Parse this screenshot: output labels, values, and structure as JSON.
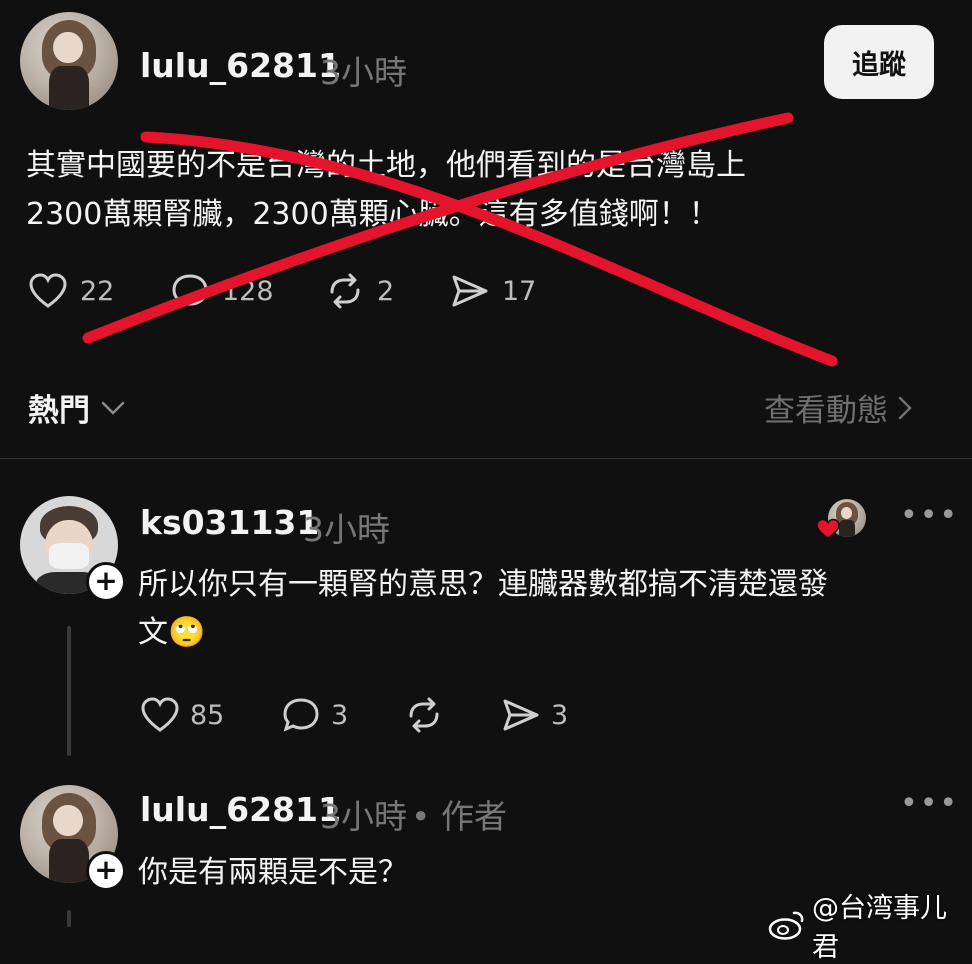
{
  "post": {
    "username": "lulu_62811",
    "time": "3小時",
    "follow_label": "追蹤",
    "text_line1": "其實中國要的不是台灣的土地，他們看到的是台灣島上",
    "text_line2": "2300萬顆腎臟，2300萬顆心臟。這有多值錢啊！！",
    "likes": "22",
    "replies": "128",
    "reposts": "2",
    "shares": "17",
    "overlay_color": "#e3142b"
  },
  "sort": {
    "label": "熱門",
    "view_activity": "查看動態"
  },
  "comments": [
    {
      "username": "ks031131",
      "time": "3小時",
      "text_line1": "所以你只有一顆腎的意思？連臟器數都搞不清楚還發",
      "text_line2": "文🙄",
      "likes": "85",
      "replies": "3",
      "shares": "3"
    },
    {
      "username": "lulu_62811",
      "time": "3小時",
      "author_tag": "• 作者",
      "text_line1": "你是有兩顆是不是？"
    }
  ],
  "watermark": "@台湾事儿君",
  "icons": [
    "heart-icon",
    "comment-icon",
    "repost-icon",
    "share-icon",
    "chevron-down-icon",
    "chevron-right-icon",
    "more-icon",
    "weibo-icon",
    "plus-icon"
  ]
}
